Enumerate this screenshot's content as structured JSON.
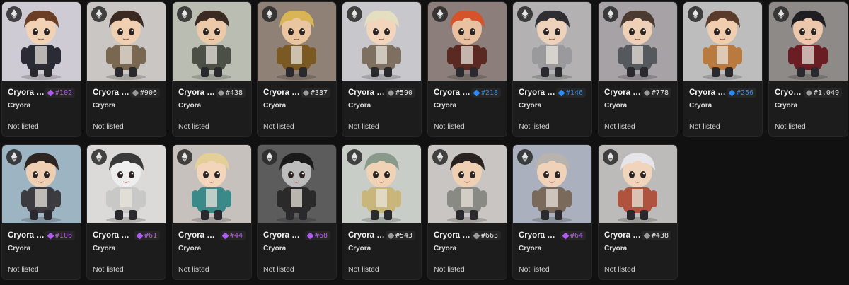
{
  "colors": {
    "purple": "#b05cf0",
    "gray": "#9a9a9a",
    "blue": "#2b8cf5"
  },
  "icon": "ethereum-icon",
  "items": [
    {
      "name": "Cryora …",
      "rank": "#102",
      "tier": "purple",
      "collection": "Cryora",
      "status": "Not listed",
      "bg": "#cfcbd4",
      "hair": "#6b3f26",
      "coat": "#2b2b35",
      "skin": "#f1d2b4"
    },
    {
      "name": "Cryora …",
      "rank": "#906",
      "tier": "gray",
      "collection": "Cryora",
      "status": "Not listed",
      "bg": "#c9c6c3",
      "hair": "#3b2a22",
      "coat": "#7a6752",
      "skin": "#f0d0b0"
    },
    {
      "name": "Cryora …",
      "rank": "#438",
      "tier": "gray",
      "collection": "Cryora",
      "status": "Not listed",
      "bg": "#b9bdb2",
      "hair": "#3a2a22",
      "coat": "#4b4f45",
      "skin": "#ecc9a9"
    },
    {
      "name": "Cryora …",
      "rank": "#337",
      "tier": "gray",
      "collection": "Cryora",
      "status": "Not listed",
      "bg": "#8f8176",
      "hair": "#d9b556",
      "coat": "#7a5a22",
      "skin": "#eac6a0"
    },
    {
      "name": "Cryora …",
      "rank": "#590",
      "tier": "gray",
      "collection": "Cryora",
      "status": "Not listed",
      "bg": "#c8c8cc",
      "hair": "#e4dfc0",
      "coat": "#7d7060",
      "skin": "#f2d5bb"
    },
    {
      "name": "Cryora …",
      "rank": "#218",
      "tier": "blue",
      "collection": "Cryora",
      "status": "Not listed",
      "bg": "#8c7f7b",
      "hair": "#d5532a",
      "coat": "#5a2a22",
      "skin": "#e9c0a0"
    },
    {
      "name": "Cryora …",
      "rank": "#146",
      "tier": "blue",
      "collection": "Cryora",
      "status": "Not listed",
      "bg": "#b3b1b2",
      "hair": "#2e2e33",
      "coat": "#9a9a9c",
      "skin": "#efd2ba"
    },
    {
      "name": "Cryora …",
      "rank": "#778",
      "tier": "gray",
      "collection": "Cryora",
      "status": "Not listed",
      "bg": "#a7a2a5",
      "hair": "#4a3a30",
      "coat": "#55585c",
      "skin": "#eed0b6"
    },
    {
      "name": "Cryora …",
      "rank": "#256",
      "tier": "blue",
      "collection": "Cryora",
      "status": "Not listed",
      "bg": "#bdbdbd",
      "hair": "#5a3a2a",
      "coat": "#b87a3e",
      "skin": "#f0cdae"
    },
    {
      "name": "Cryor…",
      "rank": "#1,049",
      "tier": "gray",
      "collection": "Cryora",
      "status": "Not listed",
      "bg": "#8e8a88",
      "hair": "#1e1e22",
      "coat": "#6a1e24",
      "skin": "#ecc7ac"
    },
    {
      "name": "Cryora …",
      "rank": "#106",
      "tier": "purple",
      "collection": "Cryora",
      "status": "Not listed",
      "bg": "#9db4c2",
      "hair": "#2e2520",
      "coat": "#3c3c40",
      "skin": "#efcfb2"
    },
    {
      "name": "Cryora #…",
      "rank": "#61",
      "tier": "purple",
      "collection": "Cryora",
      "status": "Not listed",
      "bg": "#dcdad8",
      "hair": "#3a3a3a",
      "coat": "#c8c8c6",
      "skin": "#eeeeee"
    },
    {
      "name": "Cryora …",
      "rank": "#44",
      "tier": "purple",
      "collection": "Cryora",
      "status": "Not listed",
      "bg": "#c6c1bd",
      "hair": "#e5cf98",
      "coat": "#3a8a8a",
      "skin": "#f2d5bb"
    },
    {
      "name": "Cryora #…",
      "rank": "#68",
      "tier": "purple",
      "collection": "Cryora",
      "status": "Not listed",
      "bg": "#5c5c5c",
      "hair": "#1a1a1a",
      "coat": "#2a2a2a",
      "skin": "#bdbdbd"
    },
    {
      "name": "Cryora …",
      "rank": "#543",
      "tier": "gray",
      "collection": "Cryora",
      "status": "Not listed",
      "bg": "#c8cdc8",
      "hair": "#8a9a8a",
      "coat": "#c9b67a",
      "skin": "#f0d2b5"
    },
    {
      "name": "Cryora …",
      "rank": "#663",
      "tier": "gray",
      "collection": "Cryora",
      "status": "Not listed",
      "bg": "#c9c5c2",
      "hair": "#2a2220",
      "coat": "#8a8a85",
      "skin": "#efd0b2"
    },
    {
      "name": "Cryora #…",
      "rank": "#64",
      "tier": "purple",
      "collection": "Cryora",
      "status": "Not listed",
      "bg": "#aab0bd",
      "hair": "#b9b3ad",
      "coat": "#7a6a5c",
      "skin": "#efd2b8"
    },
    {
      "name": "Cryora …",
      "rank": "#438",
      "tier": "gray",
      "collection": "Cryora",
      "status": "Not listed",
      "bg": "#bdbbb9",
      "hair": "#e6e6ea",
      "coat": "#b0533e",
      "skin": "#f1d4bc"
    }
  ]
}
